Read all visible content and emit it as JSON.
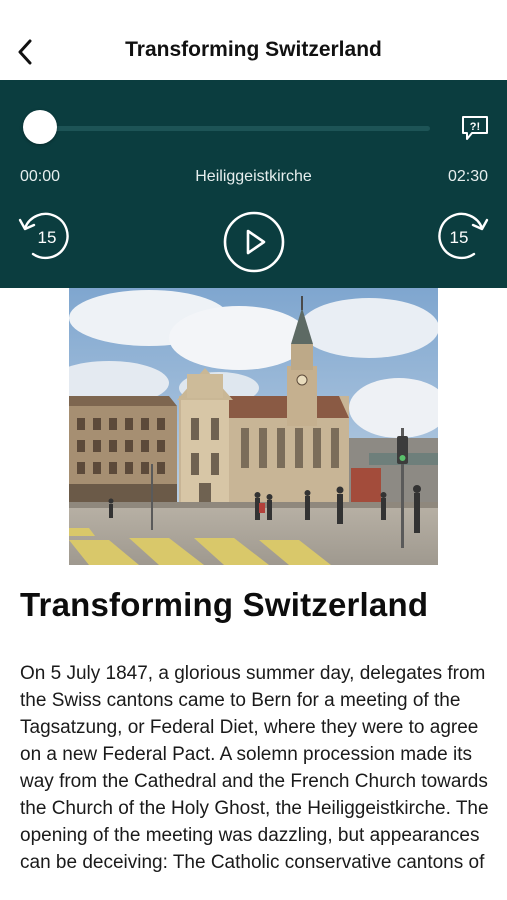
{
  "header": {
    "title": "Transforming Switzerland",
    "back_icon": "chevron-left-icon"
  },
  "player": {
    "progress": 0,
    "elapsed": "00:00",
    "track_title": "Heiliggeistkirche",
    "duration": "02:30",
    "rewind_seconds": "15",
    "forward_seconds": "15",
    "transcript_icon": "transcript-icon",
    "play_icon": "play-icon",
    "colors": {
      "background": "#0b3d3f",
      "track": "#1d5456",
      "foreground": "#ffffff"
    }
  },
  "article": {
    "image_alt": "Heiliggeistkirche church on a square in Bern",
    "title": "Transforming Switzerland",
    "body": "On 5 July 1847, a glorious summer day, delegates from the Swiss cantons came to Bern for a meeting of the Tagsatzung, or Federal Diet, where they were to agree on a new Federal Pact. A solemn procession made its way from the Cathedral and the French Church towards the Church of the Holy Ghost, the Heiliggeistkirche. The opening of the meeting was dazzling, but appearances can be deceiving: The Catholic conservative cantons of"
  }
}
